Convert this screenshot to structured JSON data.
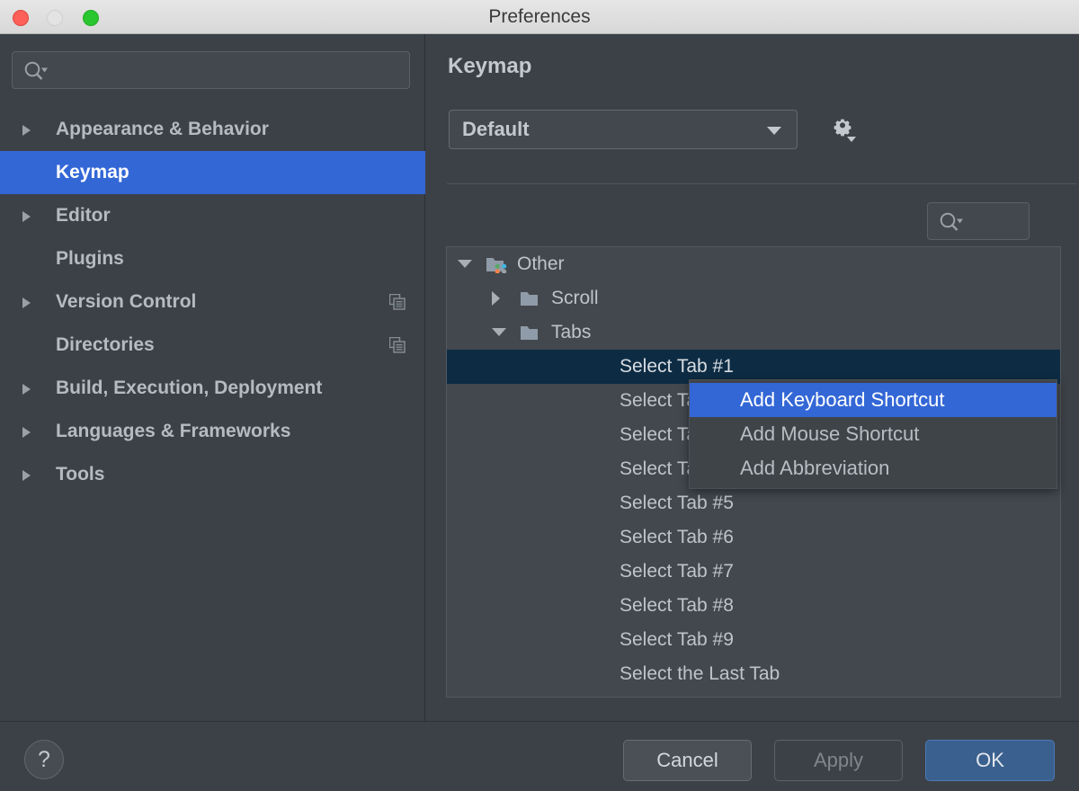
{
  "window": {
    "title": "Preferences",
    "traffic_lights": [
      "close",
      "minimize",
      "zoom"
    ]
  },
  "sidebar": {
    "search": {
      "placeholder": "",
      "value": "",
      "icon": "search-icon"
    },
    "items": [
      {
        "label": "Appearance & Behavior",
        "expandable": true,
        "selected": false,
        "badge_icon": ""
      },
      {
        "label": "Keymap",
        "expandable": false,
        "selected": true,
        "badge_icon": ""
      },
      {
        "label": "Editor",
        "expandable": true,
        "selected": false,
        "badge_icon": ""
      },
      {
        "label": "Plugins",
        "expandable": false,
        "selected": false,
        "badge_icon": ""
      },
      {
        "label": "Version Control",
        "expandable": true,
        "selected": false,
        "badge_icon": "copy-icon"
      },
      {
        "label": "Directories",
        "expandable": false,
        "selected": false,
        "badge_icon": "copy-icon"
      },
      {
        "label": "Build, Execution, Deployment",
        "expandable": true,
        "selected": false,
        "badge_icon": ""
      },
      {
        "label": "Languages & Frameworks",
        "expandable": true,
        "selected": false,
        "badge_icon": ""
      },
      {
        "label": "Tools",
        "expandable": true,
        "selected": false,
        "badge_icon": ""
      }
    ]
  },
  "main": {
    "title": "Keymap",
    "keymap_select": {
      "value": "Default",
      "icon": "chevron-down-icon"
    },
    "gear_button": {
      "icon": "gear-icon"
    },
    "toolbar": {
      "expand_all_label": "››",
      "collapse_all_label": "››",
      "search": {
        "placeholder": "",
        "value": "",
        "icon": "search-icon"
      }
    },
    "tree": [
      {
        "label": "Other",
        "depth": 0,
        "state": "expanded",
        "icon": "other-folder-icon",
        "selected": false
      },
      {
        "label": "Scroll",
        "depth": 1,
        "state": "collapsed",
        "icon": "folder-icon",
        "selected": false
      },
      {
        "label": "Tabs",
        "depth": 1,
        "state": "expanded",
        "icon": "folder-icon",
        "selected": false
      },
      {
        "label": "Select Tab #1",
        "depth": 2,
        "state": "leaf",
        "icon": "",
        "selected": true
      },
      {
        "label": "Select Tab #2",
        "depth": 2,
        "state": "leaf",
        "icon": "",
        "selected": false
      },
      {
        "label": "Select Tab #3",
        "depth": 2,
        "state": "leaf",
        "icon": "",
        "selected": false
      },
      {
        "label": "Select Tab #4",
        "depth": 2,
        "state": "leaf",
        "icon": "",
        "selected": false
      },
      {
        "label": "Select Tab #5",
        "depth": 2,
        "state": "leaf",
        "icon": "",
        "selected": false
      },
      {
        "label": "Select Tab #6",
        "depth": 2,
        "state": "leaf",
        "icon": "",
        "selected": false
      },
      {
        "label": "Select Tab #7",
        "depth": 2,
        "state": "leaf",
        "icon": "",
        "selected": false
      },
      {
        "label": "Select Tab #8",
        "depth": 2,
        "state": "leaf",
        "icon": "",
        "selected": false
      },
      {
        "label": "Select Tab #9",
        "depth": 2,
        "state": "leaf",
        "icon": "",
        "selected": false
      },
      {
        "label": "Select the Last Tab",
        "depth": 2,
        "state": "leaf",
        "icon": "",
        "selected": false
      }
    ]
  },
  "context_menu": {
    "items": [
      {
        "label": "Add Keyboard Shortcut",
        "highlighted": true
      },
      {
        "label": "Add Mouse Shortcut",
        "highlighted": false
      },
      {
        "label": "Add Abbreviation",
        "highlighted": false
      }
    ]
  },
  "footer": {
    "help_label": "?",
    "cancel_label": "Cancel",
    "apply_label": "Apply",
    "ok_label": "OK",
    "apply_enabled": false
  },
  "colors": {
    "window_bg": "#3c4147",
    "panel_bg": "#43484e",
    "accent_blue": "#3367d6",
    "tree_selection": "#0d2c44",
    "ok_button": "#3a608f",
    "text_primary": "#c3c8cd",
    "titlebar": "#e0e0e0"
  }
}
